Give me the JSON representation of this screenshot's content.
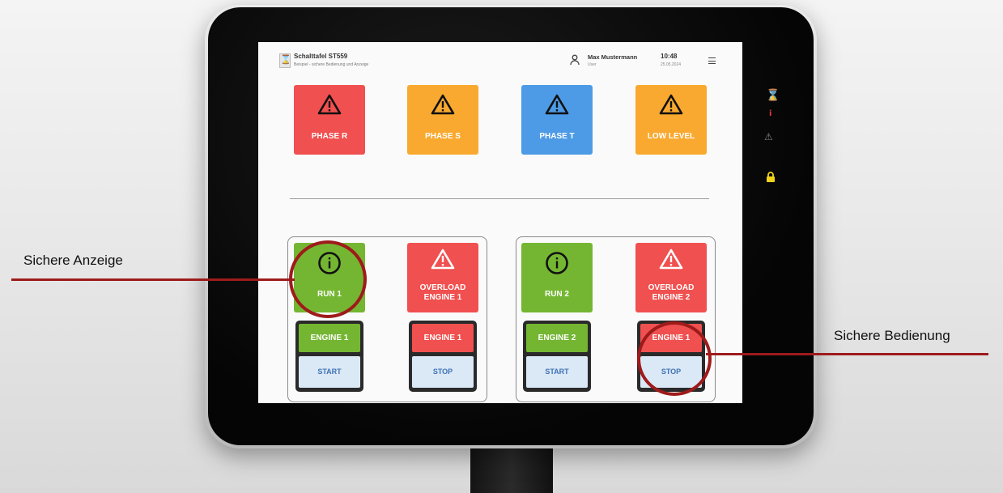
{
  "header": {
    "logo_glyph": "⌛",
    "title": "Schalttafel ST559",
    "subtitle": "Beispiel - sichere Bedienung und Anzeige",
    "user_name": "Max Mustermann",
    "user_role": "User",
    "time": "10:48",
    "date": "25.05.2024"
  },
  "alarms": [
    {
      "label": "PHASE R",
      "color": "#f0504f",
      "icon": "warning-icon"
    },
    {
      "label": "PHASE S",
      "color": "#f9a92f",
      "icon": "warning-icon"
    },
    {
      "label": "PHASE T",
      "color": "#4d9be6",
      "icon": "warning-icon"
    },
    {
      "label": "LOW LEVEL",
      "color": "#f9a92f",
      "icon": "warning-icon"
    }
  ],
  "groups": [
    {
      "status": {
        "label": "RUN 1",
        "color": "#74b632",
        "icon": "info-icon"
      },
      "overload": {
        "label_line1": "OVERLOAD",
        "label_line2": "ENGINE 1",
        "color": "#f0504f",
        "icon": "warning-icon"
      },
      "start_control": {
        "engine_label": "ENGINE 1",
        "action_label": "START",
        "color": "#74b632"
      },
      "stop_control": {
        "engine_label": "ENGINE 1",
        "action_label": "STOP",
        "color": "#f0504f"
      }
    },
    {
      "status": {
        "label": "RUN 2",
        "color": "#74b632",
        "icon": "info-icon"
      },
      "overload": {
        "label_line1": "OVERLOAD",
        "label_line2": "ENGINE 2",
        "color": "#f0504f",
        "icon": "warning-icon"
      },
      "start_control": {
        "engine_label": "ENGINE 2",
        "action_label": "START",
        "color": "#74b632"
      },
      "stop_control": {
        "engine_label": "ENGINE 1",
        "action_label": "STOP",
        "color": "#f0504f"
      }
    }
  ],
  "side_indicators": [
    {
      "icon": "hourglass-icon",
      "glyph": "⌛",
      "color": "#e23b3b"
    },
    {
      "icon": "info-icon",
      "glyph": "i",
      "color": "#e23b3b"
    },
    {
      "icon": "warning-icon",
      "glyph": "⚠",
      "color": "#8a8a8a"
    },
    {
      "icon": "lock-icon",
      "glyph": "",
      "color": "#f2d21a"
    }
  ],
  "callouts": {
    "display": "Sichere Anzeige",
    "operation": "Sichere Bedienung"
  },
  "accent_color": "#9e1b1b"
}
